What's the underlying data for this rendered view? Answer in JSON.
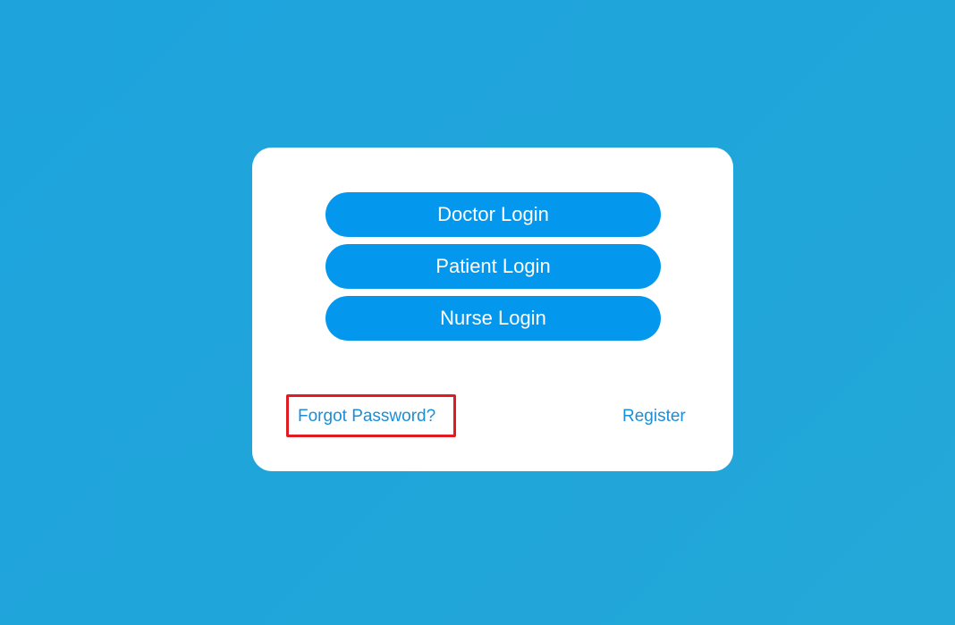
{
  "login_card": {
    "buttons": [
      {
        "label": "Doctor Login"
      },
      {
        "label": "Patient Login"
      },
      {
        "label": "Nurse Login"
      }
    ],
    "links": {
      "forgot_password": "Forgot Password?",
      "register": "Register"
    }
  },
  "colors": {
    "background": "#1ea3dc",
    "card": "#ffffff",
    "button": "#0398ee",
    "button_text": "#ffffff",
    "link": "#1a8fd8",
    "highlight": "#e01b22"
  }
}
